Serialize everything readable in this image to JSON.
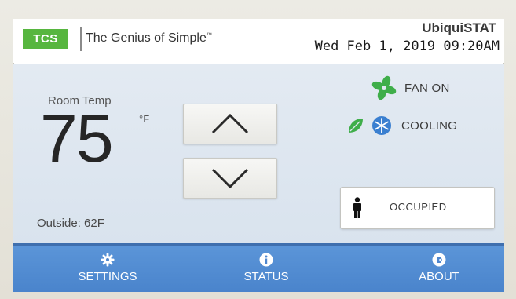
{
  "header": {
    "brand": "TCS",
    "tagline": "The Genius of Simple",
    "tagline_mark": "™",
    "product": "UbiquiSTAT",
    "datetime": "Wed Feb 1, 2019  09:20AM"
  },
  "thermostat": {
    "room_label": "Room Temp",
    "temperature": "75",
    "unit": "°F",
    "outside": "Outside: 62F",
    "up_icon": "chevron-up-icon",
    "down_icon": "chevron-down-icon"
  },
  "status": {
    "fan": {
      "icon": "fan-icon",
      "label": "FAN ON",
      "color": "#3fae4a"
    },
    "cooling": {
      "icons": [
        "leaf-icon",
        "snowflake-icon"
      ],
      "label": "COOLING",
      "leaf_color": "#3fae4a",
      "snow_color": "#3a7fd0"
    },
    "occupancy": {
      "icon": "person-icon",
      "label": "OCCUPIED"
    }
  },
  "nav": {
    "settings": {
      "icon": "gear-icon",
      "label": "SETTINGS"
    },
    "status": {
      "icon": "info-icon",
      "label": "STATUS"
    },
    "about": {
      "icon": "tag-icon",
      "label": "ABOUT"
    }
  },
  "colors": {
    "brand_green": "#57b63f",
    "nav_blue": "#4a84cc",
    "panel_bg": "#dde6f0"
  }
}
